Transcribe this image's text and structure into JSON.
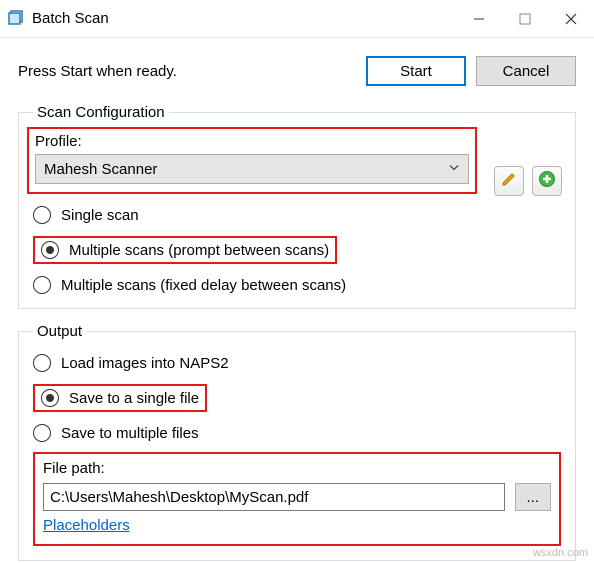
{
  "window": {
    "title": "Batch Scan"
  },
  "top": {
    "message": "Press Start when ready.",
    "start": "Start",
    "cancel": "Cancel"
  },
  "scan_config": {
    "legend": "Scan Configuration",
    "profile_label": "Profile:",
    "profile_value": "Mahesh Scanner",
    "options": {
      "single": "Single scan",
      "prompt": "Multiple scans (prompt between scans)",
      "fixed": "Multiple scans (fixed delay between scans)"
    }
  },
  "output": {
    "legend": "Output",
    "options": {
      "load": "Load images into NAPS2",
      "single_file": "Save to a single file",
      "multi_file": "Save to multiple files"
    },
    "filepath_label": "File path:",
    "filepath_value": "C:\\Users\\Mahesh\\Desktop\\MyScan.pdf",
    "browse": "...",
    "placeholders_link": "Placeholders"
  },
  "watermark": "wsxdn.com"
}
